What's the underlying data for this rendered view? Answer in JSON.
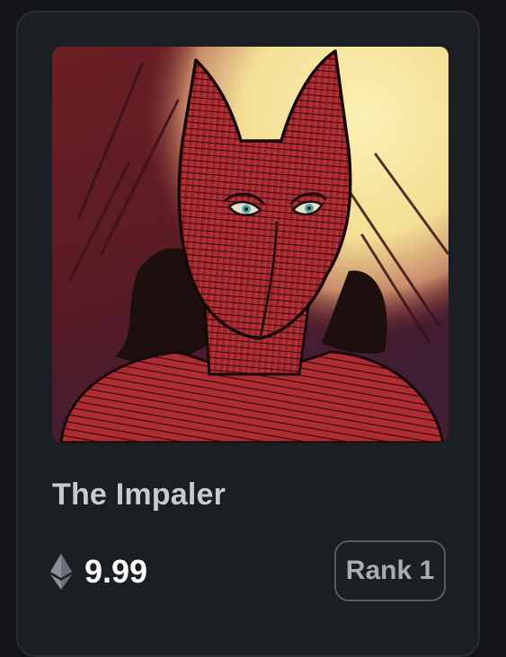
{
  "card": {
    "title": "The Impaler",
    "price": "9.99",
    "currency_icon": "ethereum-icon",
    "rank_label": "Rank 1",
    "artwork": "masked-red-figure-portrait"
  },
  "colors": {
    "page_bg": "#131518",
    "card_bg": "#1b1e22",
    "card_border": "#2b2f35",
    "title": "#c8cbd0",
    "price": "#ffffff",
    "rank_text": "#a9adb3",
    "rank_border": "#565b63",
    "art_bg_dark": "#5e1d22",
    "art_sun": "#f6e6a1",
    "art_figure": "#a9232a"
  }
}
